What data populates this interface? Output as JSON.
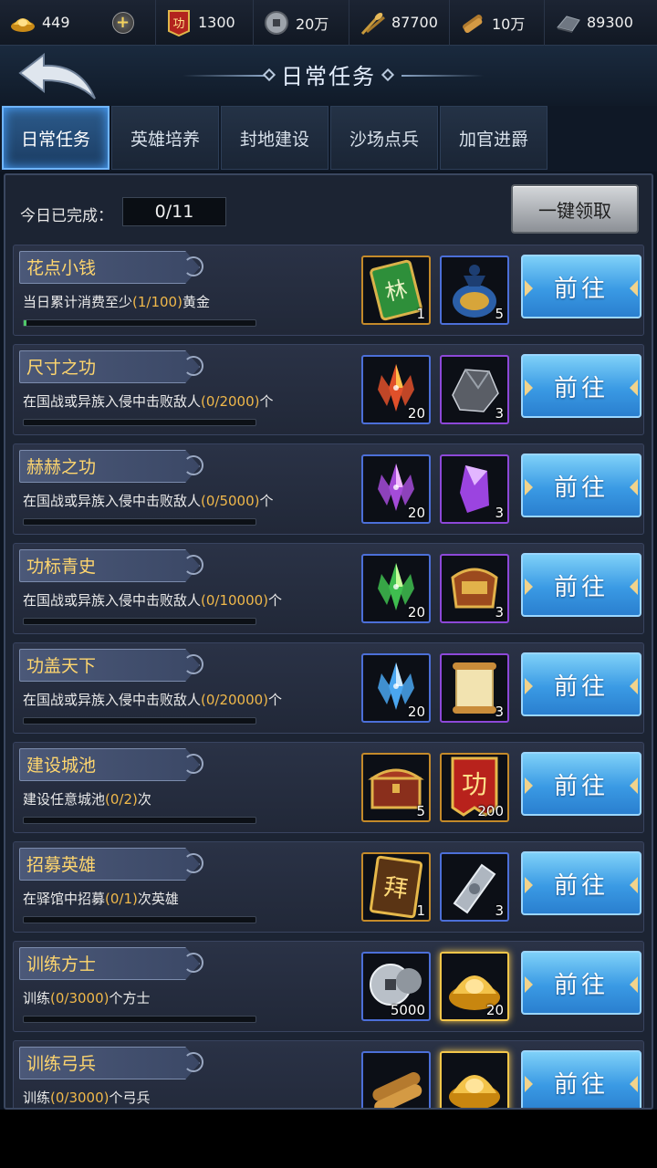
{
  "resources": [
    {
      "name": "gold-ingot-icon",
      "value": "449"
    },
    {
      "name": "merit-icon",
      "value": "1300"
    },
    {
      "name": "coin-icon",
      "value": "20万"
    },
    {
      "name": "grain-icon",
      "value": "87700"
    },
    {
      "name": "wood-icon",
      "value": "10万"
    },
    {
      "name": "iron-icon",
      "value": "89300"
    }
  ],
  "header": {
    "title": "日常任务"
  },
  "tabs": [
    {
      "label": "日常任务",
      "active": true
    },
    {
      "label": "英雄培养",
      "active": false
    },
    {
      "label": "封地建设",
      "active": false
    },
    {
      "label": "沙场点兵",
      "active": false
    },
    {
      "label": "加官进爵",
      "active": false
    }
  ],
  "summary": {
    "label": "今日已完成：",
    "value": "0/11",
    "claim_all": "一键领取"
  },
  "go_label": "前往",
  "tasks": [
    {
      "name": "花点小钱",
      "desc_pre": "当日累计消费至少",
      "progress": "(1/100)",
      "desc_post": "黄金",
      "ratio": 0.01,
      "rewards": [
        {
          "icon": "merit-token-icon",
          "qty": "1"
        },
        {
          "icon": "treasure-bag-icon",
          "qty": "5"
        }
      ]
    },
    {
      "name": "尺寸之功",
      "desc_pre": "在国战或异族入侵中击败敌人",
      "progress": "(0/2000)",
      "desc_post": "个",
      "ratio": 0,
      "rewards": [
        {
          "icon": "red-crystal-icon",
          "qty": "20"
        },
        {
          "icon": "iron-ore-icon",
          "qty": "3"
        }
      ]
    },
    {
      "name": "赫赫之功",
      "desc_pre": "在国战或异族入侵中击败敌人",
      "progress": "(0/5000)",
      "desc_post": "个",
      "ratio": 0,
      "rewards": [
        {
          "icon": "purple-crystal-icon",
          "qty": "20"
        },
        {
          "icon": "purple-gem-icon",
          "qty": "3"
        }
      ]
    },
    {
      "name": "功标青史",
      "desc_pre": "在国战或异族入侵中击败敌人",
      "progress": "(0/10000)",
      "desc_post": "个",
      "ratio": 0,
      "rewards": [
        {
          "icon": "green-crystal-icon",
          "qty": "20"
        },
        {
          "icon": "saddle-icon",
          "qty": "3"
        }
      ]
    },
    {
      "name": "功盖天下",
      "desc_pre": "在国战或异族入侵中击败敌人",
      "progress": "(0/20000)",
      "desc_post": "个",
      "ratio": 0,
      "rewards": [
        {
          "icon": "blue-crystal-icon",
          "qty": "20"
        },
        {
          "icon": "scroll-icon",
          "qty": "3"
        }
      ]
    },
    {
      "name": "建设城池",
      "desc_pre": "建设任意城池",
      "progress": "(0/2)",
      "desc_post": "次",
      "ratio": 0,
      "rewards": [
        {
          "icon": "treasure-chest-icon",
          "qty": "5"
        },
        {
          "icon": "merit-banner-icon",
          "qty": "200",
          "text": "功"
        }
      ]
    },
    {
      "name": "招募英雄",
      "desc_pre": "在驿馆中招募",
      "progress": "(0/1)",
      "desc_post": "次英雄",
      "ratio": 0,
      "rewards": [
        {
          "icon": "recruit-card-icon",
          "qty": "1",
          "text": "拜"
        },
        {
          "icon": "silver-token-icon",
          "qty": "3"
        }
      ]
    },
    {
      "name": "训练方士",
      "desc_pre": "训练",
      "progress": "(0/3000)",
      "desc_post": "个方士",
      "ratio": 0,
      "rewards": [
        {
          "icon": "silver-coins-icon",
          "qty": "5000"
        },
        {
          "icon": "gold-ingot-reward-icon",
          "qty": "20"
        }
      ]
    },
    {
      "name": "训练弓兵",
      "desc_pre": "训练",
      "progress": "(0/3000)",
      "desc_post": "个弓兵",
      "ratio": 0,
      "rewards": [
        {
          "icon": "wood-logs-icon",
          "qty": ""
        },
        {
          "icon": "gold-ingot-reward-icon",
          "qty": ""
        }
      ]
    }
  ]
}
